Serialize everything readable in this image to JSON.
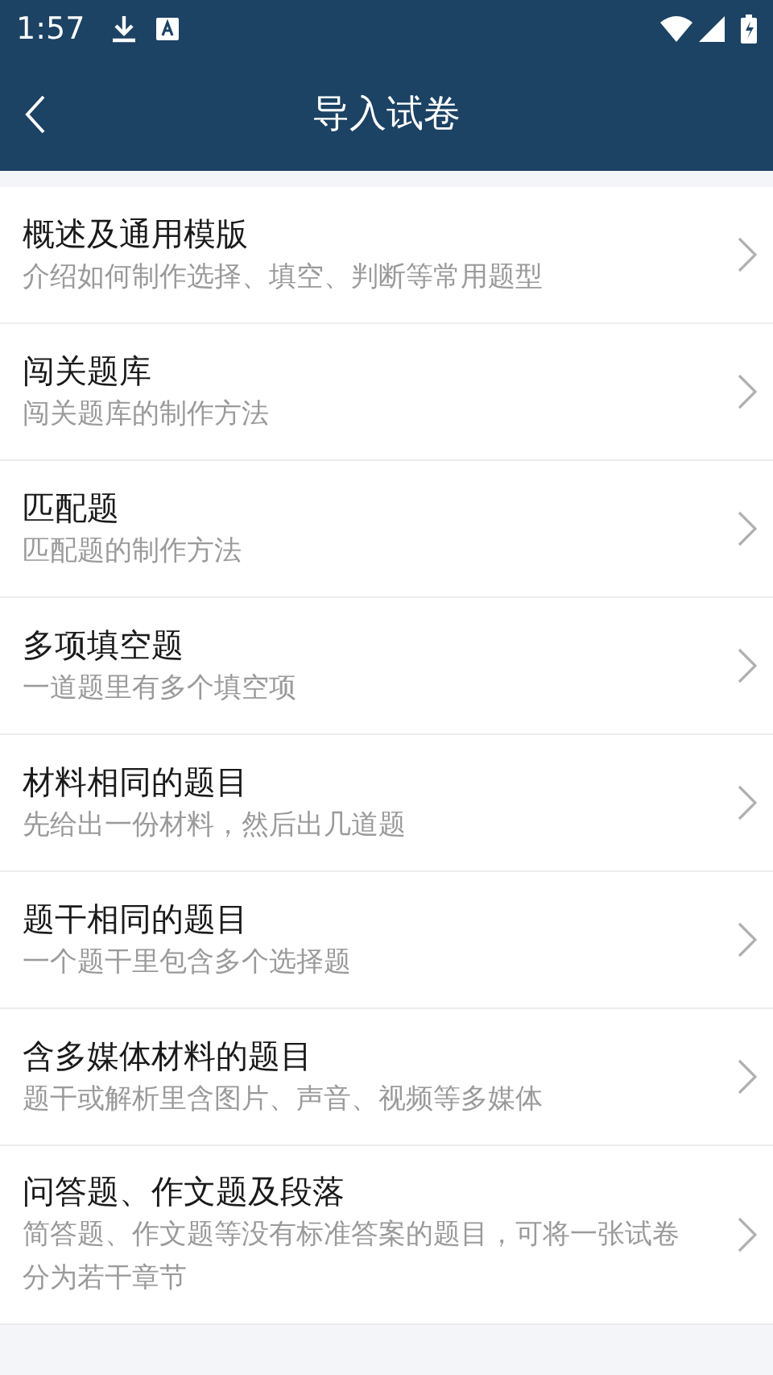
{
  "status_bar": {
    "time": "1:57"
  },
  "header": {
    "title": "导入试卷"
  },
  "items": [
    {
      "title": "概述及通用模版",
      "subtitle": "介绍如何制作选择、填空、判断等常用题型"
    },
    {
      "title": "闯关题库",
      "subtitle": "闯关题库的制作方法"
    },
    {
      "title": "匹配题",
      "subtitle": "匹配题的制作方法"
    },
    {
      "title": "多项填空题",
      "subtitle": "一道题里有多个填空项"
    },
    {
      "title": "材料相同的题目",
      "subtitle": "先给出一份材料，然后出几道题"
    },
    {
      "title": "题干相同的题目",
      "subtitle": "一个题干里包含多个选择题"
    },
    {
      "title": "含多媒体材料的题目",
      "subtitle": "题干或解析里含图片、声音、视频等多媒体"
    },
    {
      "title": "问答题、作文题及段落",
      "subtitle": "简答题、作文题等没有标准答案的题目，可将一张试卷分为若干章节"
    }
  ]
}
